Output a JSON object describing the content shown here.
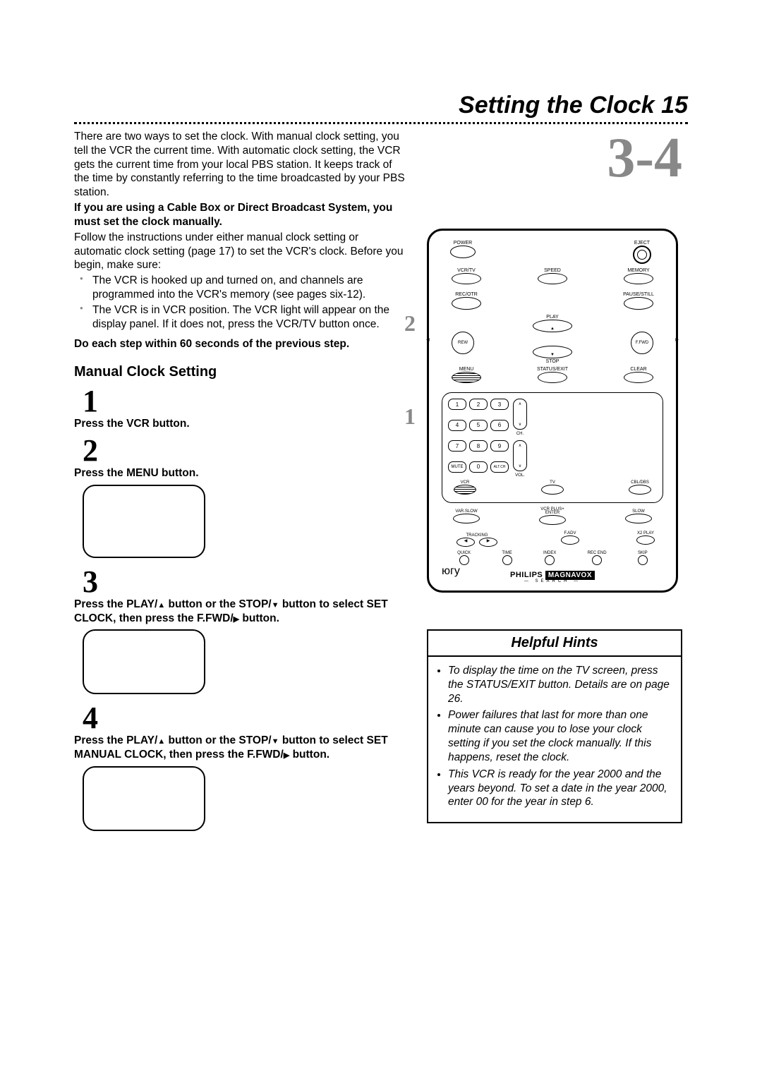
{
  "header": {
    "title": "Setting the Clock",
    "page_number": "15",
    "step_range": "3-4"
  },
  "intro": {
    "p1": "There are two ways to set the clock. With manual clock setting, you tell the VCR the current time. With automatic clock setting, the VCR gets the current time from your local PBS station. It keeps track of the time by constantly referring to the time broadcasted by your PBS station.",
    "warn": "If you are using a Cable Box or Direct Broadcast System, you must set the clock manually.",
    "p2": "Follow the instructions under either manual clock setting or automatic clock setting (page 17) to set the VCR's clock. Before you begin, make sure:",
    "bullets": [
      "The VCR is hooked up and turned on, and channels are programmed into the VCR's memory (see pages six-12).",
      "The VCR is in VCR position. The VCR light will appear on the display panel. If it does not, press the VCR/TV button once."
    ],
    "limit": "Do each step within 60 seconds of the previous step."
  },
  "section_title": "Manual Clock Setting",
  "steps": {
    "s1": {
      "num": "1",
      "text": "Press the VCR button."
    },
    "s2": {
      "num": "2",
      "text": "Press the MENU button."
    },
    "s3": {
      "num": "3",
      "text_a": "Press the PLAY/",
      "text_b": " button or the STOP/",
      "text_c": " button to select SET CLOCK, then press the F.FWD/",
      "text_d": " button."
    },
    "s4": {
      "num": "4",
      "text_a": "Press the PLAY/",
      "text_b": " button or the STOP/",
      "text_c": " button to select SET MANUAL CLOCK, then press the F.FWD/",
      "text_d": " button."
    }
  },
  "remote_callouts": {
    "c1": "1",
    "c2": "2"
  },
  "remote": {
    "labels": {
      "power": "POWER",
      "eject": "EJECT",
      "vcrtv": "VCR/TV",
      "speed": "SPEED",
      "memory": "MEMORY",
      "recotr": "REC/OTR",
      "pause": "PAUSE/STILL",
      "play": "PLAY",
      "rew": "REW",
      "ffwd": "F.FWD",
      "stop": "STOP",
      "menu": "MENU",
      "status": "STATUS/EXIT",
      "clear": "CLEAR",
      "mute": "MUTE",
      "altch": "ALT.CH",
      "ch": "CH.",
      "vol": "VOL.",
      "vcr": "VCR",
      "tv": "TV",
      "cbldbs": "CBL/DBS",
      "varslow": "VAR.SLOW",
      "vcrplus": "VCR PLUS+",
      "enter": "ENTER",
      "slow": "SLOW",
      "tracking": "TRACKING",
      "fadv": "F.ADV",
      "x2": "X2 PLAY",
      "quick": "QUICK",
      "time": "TIME",
      "index": "INDEX",
      "recend": "REC END",
      "skip": "SKIP",
      "search": "SEARCH"
    },
    "numbers": [
      "1",
      "2",
      "3",
      "4",
      "5",
      "6",
      "7",
      "8",
      "9",
      "0"
    ],
    "brand": {
      "a": "PHILIPS",
      "b": "MAGNAVOX"
    }
  },
  "hints": {
    "title": "Helpful Hints",
    "items": [
      "To display the time on the TV screen, press the STATUS/EXIT button. Details are on page 26.",
      "Power failures that last for more than one minute can cause you to lose your clock setting if you set the clock manually. If this happens, reset the clock.",
      "This VCR is ready for the year 2000 and the years beyond. To set a date in the year 2000, enter 00 for the year in step 6."
    ]
  }
}
